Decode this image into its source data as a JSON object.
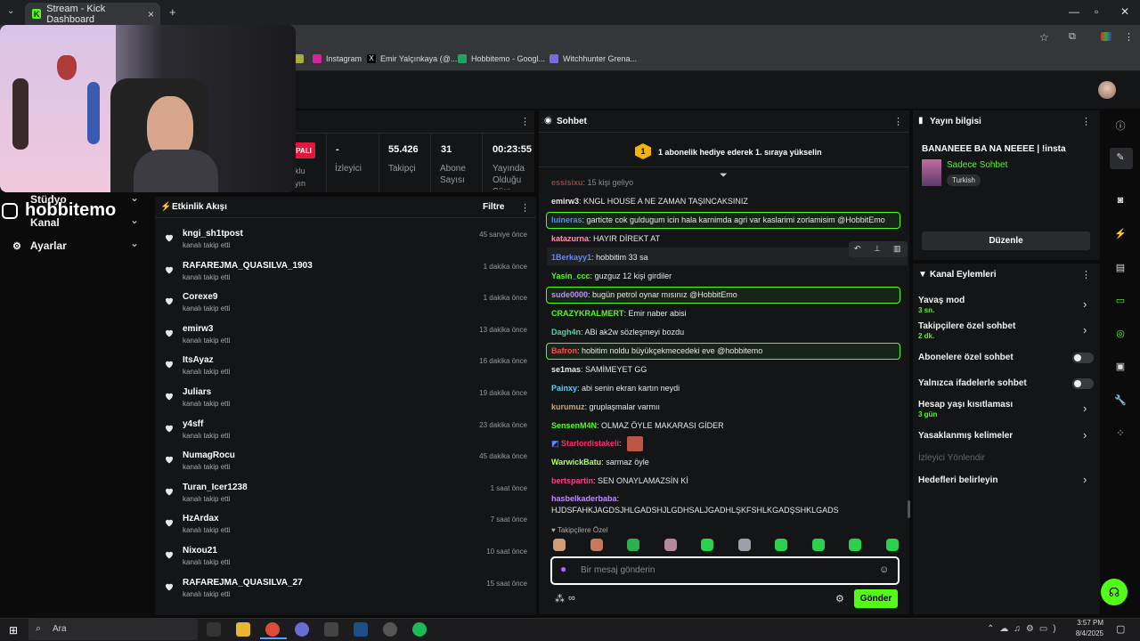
{
  "browser": {
    "tab_title": "Stream - Kick Dashboard",
    "bookmarks": [
      "Instagram",
      "Emir Yalçınkaya (@...",
      "Hobbitemo - Googl...",
      "Witchhunter Grena..."
    ]
  },
  "stats": [
    {
      "value": "-",
      "label": "İzleyici"
    },
    {
      "value": "55.426",
      "label": "Takipçi"
    },
    {
      "value": "31",
      "label": "Abone Sayısı"
    },
    {
      "value": "00:23:55",
      "label": "Yayında Olduğu Süre"
    }
  ],
  "stats_partial": {
    "badge": "PALI",
    "cut1": "klu",
    "cut2": "yın"
  },
  "overlay": {
    "handle": "hobbitemo"
  },
  "sidebar": {
    "items": [
      "Stüdyo",
      "Kanal",
      "Ayarlar"
    ]
  },
  "activity": {
    "title": "Etkinlik Akışı",
    "filter": "Filtre",
    "items": [
      {
        "name": "kngi_sh1tpost",
        "sub": "kanalı takip etti",
        "time": "45 saniye önce"
      },
      {
        "name": "RAFAREJMA_QUASILVA_1903",
        "sub": "kanalı takip etti",
        "time": "1 dakika önce"
      },
      {
        "name": "Corexe9",
        "sub": "kanalı takip etti",
        "time": "1 dakika önce"
      },
      {
        "name": "emirw3",
        "sub": "kanalı takip etti",
        "time": "13 dakika önce"
      },
      {
        "name": "ItsAyaz",
        "sub": "kanalı takip etti",
        "time": "16 dakika önce"
      },
      {
        "name": "Juliars",
        "sub": "kanalı takip etti",
        "time": "19 dakika önce"
      },
      {
        "name": "y4sff",
        "sub": "kanalı takip etti",
        "time": "23 dakika önce"
      },
      {
        "name": "NumagRocu",
        "sub": "kanalı takip etti",
        "time": "45 dakika önce"
      },
      {
        "name": "Turan_Icer1238",
        "sub": "kanalı takip etti",
        "time": "1 saat önce"
      },
      {
        "name": "HzArdax",
        "sub": "kanalı takip etti",
        "time": "7 saat önce"
      },
      {
        "name": "Nixou21",
        "sub": "kanalı takip etti",
        "time": "10 saat önce"
      },
      {
        "name": "RAFAREJMA_QUASILVA_27",
        "sub": "kanalı takip etti",
        "time": "15 saat önce"
      }
    ]
  },
  "chat": {
    "title": "Sohbet",
    "gift_count": "1",
    "gift_text": "1 abonelik hediye ederek 1. sıraya yükselin",
    "messages": [
      {
        "user": "essisixu",
        "text": "15 kişi geliyo",
        "color": "#ff6b6b"
      },
      {
        "user": "emirw3",
        "text": "KNGL HOUSE A NE ZAMAN TAŞINCAKSINIZ",
        "color": "#e8e8e8"
      },
      {
        "user": "luineras",
        "text": "garticte cok guldugum icin hala karnimda agri var kaslarimi zorlamisim @HobbitEmo",
        "color": "#4d8cff"
      },
      {
        "user": "katazurna",
        "text": "HAYIR DİREKT AT",
        "color": "#ff8fb1"
      },
      {
        "user": "1Berkayy1",
        "text": "hobbitim 33 sa",
        "color": "#5b8cff"
      },
      {
        "user": "Yasin_ccc",
        "text": "guzguz 12 kişi girdiler",
        "color": "#53fc18"
      },
      {
        "user": "sude0000",
        "text": "bugün petrol oynar mısınız @HobbitEmo",
        "color": "#c18cff"
      },
      {
        "user": "CRAZYKRALMERT",
        "text": "Emir naber abisi",
        "color": "#53fc18"
      },
      {
        "user": "Dagh4n",
        "text": "ABi ak2w sözleşmeyi bozdu",
        "color": "#53d5a0"
      },
      {
        "user": "Bafron",
        "text": "hobitim noldu büyükçekmecedeki eve @hobbitemo",
        "color": "#ff4d4d"
      },
      {
        "user": "se1mas",
        "text": "SAMİMEYET GG",
        "color": "#e8e8e8"
      },
      {
        "user": "Painxy",
        "text": "abi senin ekran kartın neydi",
        "color": "#5bd0ff"
      },
      {
        "user": "kurumuz",
        "text": "gruplaşmalar varmıı",
        "color": "#c9a86b"
      },
      {
        "user": "SensenM4N",
        "text": "OLMAZ ÖYLE MAKARASI GİDER",
        "color": "#53fc18"
      },
      {
        "user": "Starlordistakeli",
        "text": "",
        "color": "#ff2d6f"
      },
      {
        "user": "WarwickBatu",
        "text": "sarmaz öyle",
        "color": "#a8ff6b"
      },
      {
        "user": "bertspartin",
        "text": "SEN ONAYLAMAZSİN Kİ",
        "color": "#ff3d8b"
      },
      {
        "user": "hasbelkaderbaba",
        "text": "",
        "color": "#c18cff"
      }
    ],
    "last_line": "HJDSFAHKJAGDSJHLGADSHJLGDHSALJGADHLŞKFSHLKGADŞSHKLGADS",
    "followers_only": "Takipçilere Özel",
    "input_placeholder": "Bir mesaj gönderin",
    "send_label": "Gönder"
  },
  "stream_info": {
    "title": "Yayın bilgisi",
    "stream_title": "BANANEEE BA NA NEEEE | !insta",
    "category": "Sadece Sohbet",
    "tag": "Turkish",
    "edit_label": "Düzenle"
  },
  "channel_actions": {
    "title": "Kanal Eylemleri",
    "items": [
      {
        "label": "Yavaş mod",
        "sub": "3 sn."
      },
      {
        "label": "Takipçilere özel sohbet",
        "sub": "2 dk."
      },
      {
        "label": "Abonelere özel sohbet",
        "sub": ""
      },
      {
        "label": "Yalnızca ifadelerle sohbet",
        "sub": ""
      },
      {
        "label": "Hesap yaşı kısıtlaması",
        "sub": "3 gün"
      },
      {
        "label": "Yasaklanmış kelimeler",
        "sub": ""
      },
      {
        "label": "İzleyici Yönlendir",
        "sub": ""
      },
      {
        "label": "Hedefleri belirleyin",
        "sub": ""
      }
    ]
  },
  "taskbar": {
    "search": "Ara",
    "time": "3:57 PM",
    "date": "8/4/2025"
  }
}
